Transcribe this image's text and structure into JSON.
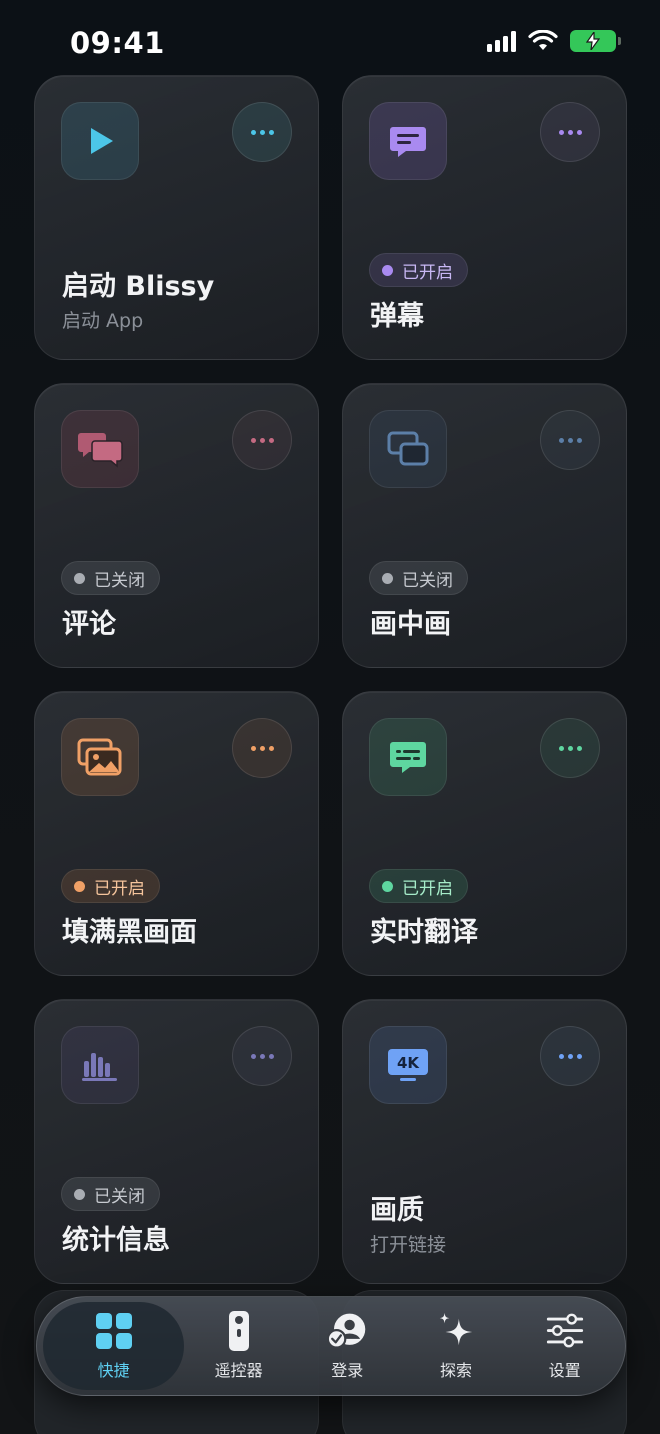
{
  "status_bar": {
    "time": "09:41"
  },
  "cards": [
    {
      "id": "launch",
      "title": "启动 Blissy",
      "subtitle": "启动 App",
      "icon": "play-icon",
      "accent": "#4cc6e8"
    },
    {
      "id": "danmaku",
      "title": "弹幕",
      "status": "已开启",
      "icon": "chat-bubble-icon",
      "accent": "#a98af0"
    },
    {
      "id": "comments",
      "title": "评论",
      "status": "已关闭",
      "icon": "comments-icon",
      "accent": "#c46a82"
    },
    {
      "id": "pip",
      "title": "画中画",
      "status": "已关闭",
      "icon": "picture-in-picture-icon",
      "accent": "#5c7fa8"
    },
    {
      "id": "fill-black",
      "title": "填满黑画面",
      "status": "已开启",
      "icon": "images-icon",
      "accent": "#f0a066"
    },
    {
      "id": "translate",
      "title": "实时翻译",
      "status": "已开启",
      "icon": "subtitle-icon",
      "accent": "#5ed6a0"
    },
    {
      "id": "stats",
      "title": "统计信息",
      "status": "已关闭",
      "icon": "bar-chart-icon",
      "accent": "#7a78b8"
    },
    {
      "id": "quality",
      "title": "画质",
      "subtitle": "打开链接",
      "icon": "4k-icon",
      "icon_text": "4K",
      "accent": "#6fa2f5"
    }
  ],
  "tab_bar": {
    "tabs": [
      {
        "label": "快捷",
        "icon": "grid-icon",
        "active": true
      },
      {
        "label": "遥控器",
        "icon": "remote-icon",
        "active": false
      },
      {
        "label": "登录",
        "icon": "account-icon",
        "active": false
      },
      {
        "label": "探索",
        "icon": "sparkle-icon",
        "active": false
      },
      {
        "label": "设置",
        "icon": "sliders-icon",
        "active": false
      }
    ]
  },
  "colors": {
    "active_tab": "#5fd0f2",
    "status_on_purple": "#a98af0",
    "status_on_orange": "#f0a066",
    "status_on_green": "#5ed6a0",
    "status_off": "#c7cad0",
    "battery": "#34c759"
  }
}
